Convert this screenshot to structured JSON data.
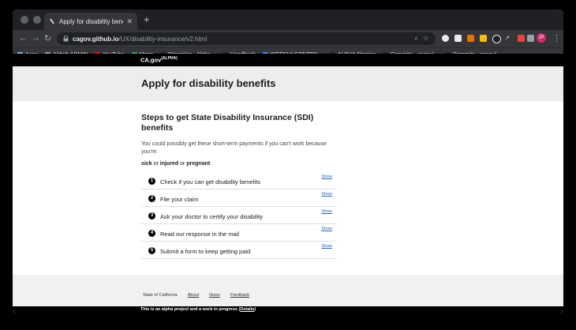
{
  "browser": {
    "tab_title": "Apply for disability benefits - A",
    "url_host": "cagov.github.io",
    "url_path": "/UX/disability-insurance/v2.html",
    "avatar_initials": "JP",
    "bookmarks": [
      {
        "label": "Apps",
        "icon_color": "#8ab4f8"
      },
      {
        "label": "Airbnb ADMIN",
        "icon_color": "#9aa0a6"
      },
      {
        "label": "YouTube",
        "icon_color": "#ff0000"
      },
      {
        "label": "Maps",
        "icon_color": "#34a853"
      },
      {
        "label": "Principles - Alpha...",
        "icon_color": "#202124"
      },
      {
        "label": "Handbook",
        "icon_color": "#202124"
      },
      {
        "label": "WEEKLY CONTEN...",
        "icon_color": "#4285f4"
      },
      {
        "label": "ALPHA Staging",
        "icon_color": "#202124"
      },
      {
        "label": "Commits · cagov/...",
        "icon_color": "#202124"
      },
      {
        "label": "Commits · cagov/...",
        "icon_color": "#202124"
      }
    ]
  },
  "site": {
    "logo": "CA.gov",
    "logo_sup": "(ALPHA)",
    "page_title": "Apply for disability benefits",
    "section_title": "Steps to get State Disability Insurance (SDI) benefits",
    "intro": "You could possibly get these short-term payments if you can't work because you're:",
    "conditions": [
      "sick",
      "or",
      "injured",
      "or",
      "pregnant",
      "."
    ],
    "show_label": "Show",
    "steps": [
      {
        "num": "1",
        "title": "Check if you can get disability benefits"
      },
      {
        "num": "2",
        "title": "File your claim"
      },
      {
        "num": "3",
        "title": "Ask your doctor to certify your disability"
      },
      {
        "num": "4",
        "title": "Read our response in the mail"
      },
      {
        "num": "5",
        "title": "Submit a form to keep getting paid"
      }
    ],
    "footer": {
      "state": "State of California",
      "links": [
        "About",
        "News",
        "Feedback"
      ]
    },
    "alpha_notice": "This is an alpha project and a work in progress (",
    "alpha_link": "Details",
    "alpha_close": ")"
  }
}
